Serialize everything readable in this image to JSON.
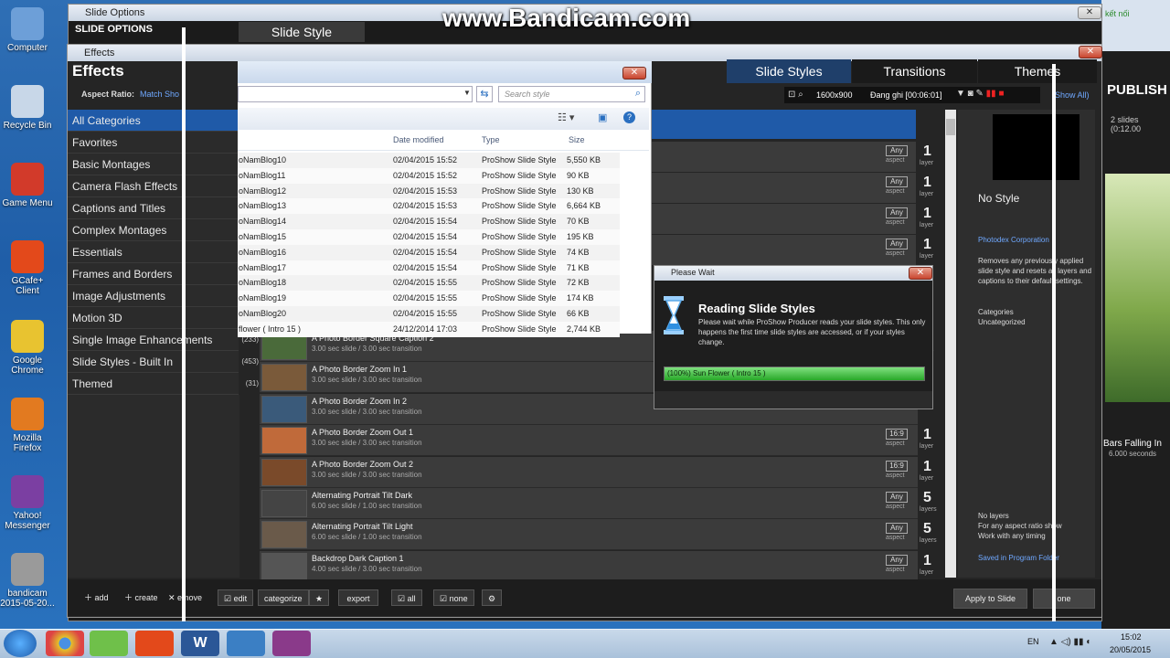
{
  "watermark": "www.Bandicam.com",
  "desktop": {
    "icons": [
      {
        "label": "Computer",
        "color": "#6d9fd8"
      },
      {
        "label": "Recycle Bin",
        "color": "#c8d7e8"
      },
      {
        "label": "Game Menu",
        "color": "#d23a2a"
      },
      {
        "label": "GCafe+ Client",
        "color": "#e3491b"
      },
      {
        "label": "Google Chrome",
        "color": "#e8c330"
      },
      {
        "label": "Mozilla Firefox",
        "color": "#e27a20"
      },
      {
        "label": "Yahoo! Messenger",
        "color": "#7b3fa2"
      },
      {
        "label": "bandicam 2015-05-20...",
        "color": "#9a9a9a"
      }
    ]
  },
  "slide_options": {
    "title": "Slide Options",
    "header_left": "SLIDE OPTIONS",
    "header_tab": "Slide Style"
  },
  "effects": {
    "title": "Effects",
    "heading": "Effects",
    "aspect_label": "Aspect Ratio:",
    "aspect_value": "Match Sho",
    "tabs": [
      "Slide Styles",
      "Transitions",
      "Themes"
    ],
    "toolbar": {
      "resolution": "1600x900",
      "recording": "Đang ghi [00:06:01]",
      "show_all": "Show All)"
    },
    "categories": [
      {
        "label": "All Categories",
        "count": ""
      },
      {
        "label": "Favorites",
        "count": ""
      },
      {
        "label": "Basic Montages",
        "count": ""
      },
      {
        "label": "Camera Flash Effects",
        "count": ""
      },
      {
        "label": "Captions and Titles",
        "count": ""
      },
      {
        "label": "Complex Montages",
        "count": ""
      },
      {
        "label": "Essentials",
        "count": ""
      },
      {
        "label": "Frames and Borders",
        "count": ""
      },
      {
        "label": "Image Adjustments",
        "count": ""
      },
      {
        "label": "Motion 3D",
        "count": ""
      },
      {
        "label": "Single Image Enhancements",
        "count": "(233)"
      },
      {
        "label": "Slide Styles - Built In",
        "count": "(453)"
      },
      {
        "label": "Themed",
        "count": "(31)"
      }
    ],
    "styles": [
      {
        "name": "A Photo Border Square Caption 2",
        "sub": "3.00 sec slide / 3.00 sec transition",
        "aspect": "Any",
        "layers": "1",
        "layer_word": "layer"
      },
      {
        "name": "A Photo Border Zoom In 1",
        "sub": "3.00 sec slide / 3.00 sec transition",
        "aspect": "",
        "layers": "",
        "layer_word": ""
      },
      {
        "name": "A Photo Border Zoom In 2",
        "sub": "3.00 sec slide / 3.00 sec transition",
        "aspect": "",
        "layers": "",
        "layer_word": ""
      },
      {
        "name": "A Photo Border Zoom Out 1",
        "sub": "3.00 sec slide / 3.00 sec transition",
        "aspect": "16:9",
        "layers": "1",
        "layer_word": "layer"
      },
      {
        "name": "A Photo Border Zoom Out 2",
        "sub": "3.00 sec slide / 3.00 sec transition",
        "aspect": "16:9",
        "layers": "1",
        "layer_word": "layer"
      },
      {
        "name": "Alternating Portrait Tilt Dark",
        "sub": "6.00 sec slide / 1.00 sec transition",
        "aspect": "Any",
        "layers": "5",
        "layer_word": "layers"
      },
      {
        "name": "Alternating Portrait Tilt Light",
        "sub": "6.00 sec slide / 1.00 sec transition",
        "aspect": "Any",
        "layers": "5",
        "layer_word": "layers"
      },
      {
        "name": "Backdrop Dark Caption 1",
        "sub": "4.00 sec slide / 3.00 sec transition",
        "aspect": "Any",
        "layers": "1",
        "layer_word": "layer"
      }
    ],
    "upper_meta": [
      {
        "aspect": "Any",
        "layers": "1",
        "layer_word": "layer"
      },
      {
        "aspect": "Any",
        "layers": "1",
        "layer_word": "layer"
      },
      {
        "aspect": "Any",
        "layers": "1",
        "layer_word": "layer"
      },
      {
        "aspect": "Any",
        "layers": "1",
        "layer_word": "layer"
      }
    ],
    "side": {
      "preview_title": "No Style",
      "company": "Photodex Corporation",
      "description": "Removes any previously applied slide style and resets all layers and captions to their default settings.",
      "categories_label": "Categories",
      "categories_value": "Uncategorized",
      "no_layers": "No layers",
      "any_aspect": "For any aspect ratio show",
      "work_any": "Work with any timing",
      "saved": "Saved in Program Folder"
    },
    "bottom": {
      "add": "add",
      "create": "create",
      "remove": "emove",
      "edit": "edit",
      "categorize": "categorize",
      "export": "export",
      "all": "all",
      "none": "none",
      "apply": "Apply to Slide",
      "done": "one"
    }
  },
  "file_dialog": {
    "search_placeholder": "Search style",
    "columns": [
      "Date modified",
      "Type",
      "Size"
    ],
    "rows": [
      {
        "name": "oNamBlog10",
        "date": "02/04/2015 15:52",
        "type": "ProShow Slide Style",
        "size": "5,550 KB"
      },
      {
        "name": "oNamBlog11",
        "date": "02/04/2015 15:52",
        "type": "ProShow Slide Style",
        "size": "90 KB"
      },
      {
        "name": "oNamBlog12",
        "date": "02/04/2015 15:53",
        "type": "ProShow Slide Style",
        "size": "130 KB"
      },
      {
        "name": "oNamBlog13",
        "date": "02/04/2015 15:53",
        "type": "ProShow Slide Style",
        "size": "6,664 KB"
      },
      {
        "name": "oNamBlog14",
        "date": "02/04/2015 15:54",
        "type": "ProShow Slide Style",
        "size": "70 KB"
      },
      {
        "name": "oNamBlog15",
        "date": "02/04/2015 15:54",
        "type": "ProShow Slide Style",
        "size": "195 KB"
      },
      {
        "name": "oNamBlog16",
        "date": "02/04/2015 15:54",
        "type": "ProShow Slide Style",
        "size": "74 KB"
      },
      {
        "name": "oNamBlog17",
        "date": "02/04/2015 15:54",
        "type": "ProShow Slide Style",
        "size": "71 KB"
      },
      {
        "name": "oNamBlog18",
        "date": "02/04/2015 15:55",
        "type": "ProShow Slide Style",
        "size": "72 KB"
      },
      {
        "name": "oNamBlog19",
        "date": "02/04/2015 15:55",
        "type": "ProShow Slide Style",
        "size": "174 KB"
      },
      {
        "name": "oNamBlog20",
        "date": "02/04/2015 15:55",
        "type": "ProShow Slide Style",
        "size": "66 KB"
      },
      {
        "name": "flower ( Intro 15 )",
        "date": "24/12/2014 17:03",
        "type": "ProShow Slide Style",
        "size": "2,744 KB"
      }
    ]
  },
  "please_wait": {
    "title": "Please Wait",
    "heading": "Reading Slide Styles",
    "body": "Please wait while ProShow Producer reads your slide styles. This only happens the first time slide styles are accessed, or if your styles change.",
    "progress_label": "(100%) Sun Flower ( Intro 15 )",
    "progress": 1.0
  },
  "background_app": {
    "publish": "PUBLISH",
    "slides": "2 slides (0:12.00",
    "ketnoi": "kết nối",
    "bars_title": "Bars Falling In",
    "bars_sub": "6.000 seconds"
  },
  "taskbar": {
    "lang": "EN",
    "time": "15:02",
    "date": "20/05/2015"
  }
}
